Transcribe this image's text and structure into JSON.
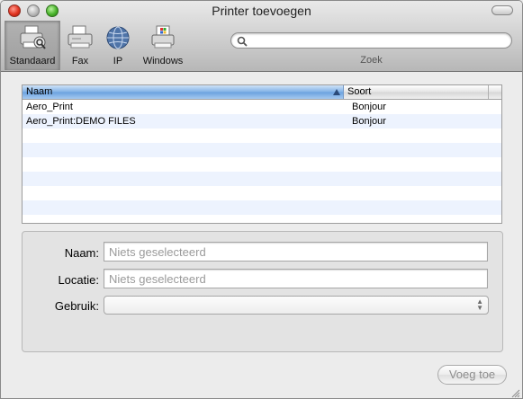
{
  "window": {
    "title": "Printer toevoegen"
  },
  "toolbar": {
    "items": [
      {
        "label": "Standaard",
        "icon": "default-printer-icon",
        "selected": true
      },
      {
        "label": "Fax",
        "icon": "fax-icon",
        "selected": false
      },
      {
        "label": "IP",
        "icon": "globe-icon",
        "selected": false
      },
      {
        "label": "Windows",
        "icon": "windows-printer-icon",
        "selected": false
      }
    ],
    "search": {
      "placeholder": "",
      "label": "Zoek",
      "icon": "search-icon"
    }
  },
  "table": {
    "columns": [
      "Naam",
      "Soort"
    ],
    "sorted_column": "Naam",
    "rows": [
      {
        "name": "Aero_Print",
        "type": "Bonjour"
      },
      {
        "name": "Aero_Print:DEMO FILES",
        "type": "Bonjour"
      }
    ]
  },
  "form": {
    "name_label": "Naam:",
    "name_placeholder": "Niets geselecteerd",
    "location_label": "Locatie:",
    "location_placeholder": "Niets geselecteerd",
    "usage_label": "Gebruik:",
    "usage_value": ""
  },
  "actions": {
    "add_label": "Voeg toe"
  },
  "colors": {
    "header_selected": "#7fb0e6",
    "row_alt": "#edf3fe",
    "close": "#e0321f",
    "zoom": "#4ab42c"
  }
}
